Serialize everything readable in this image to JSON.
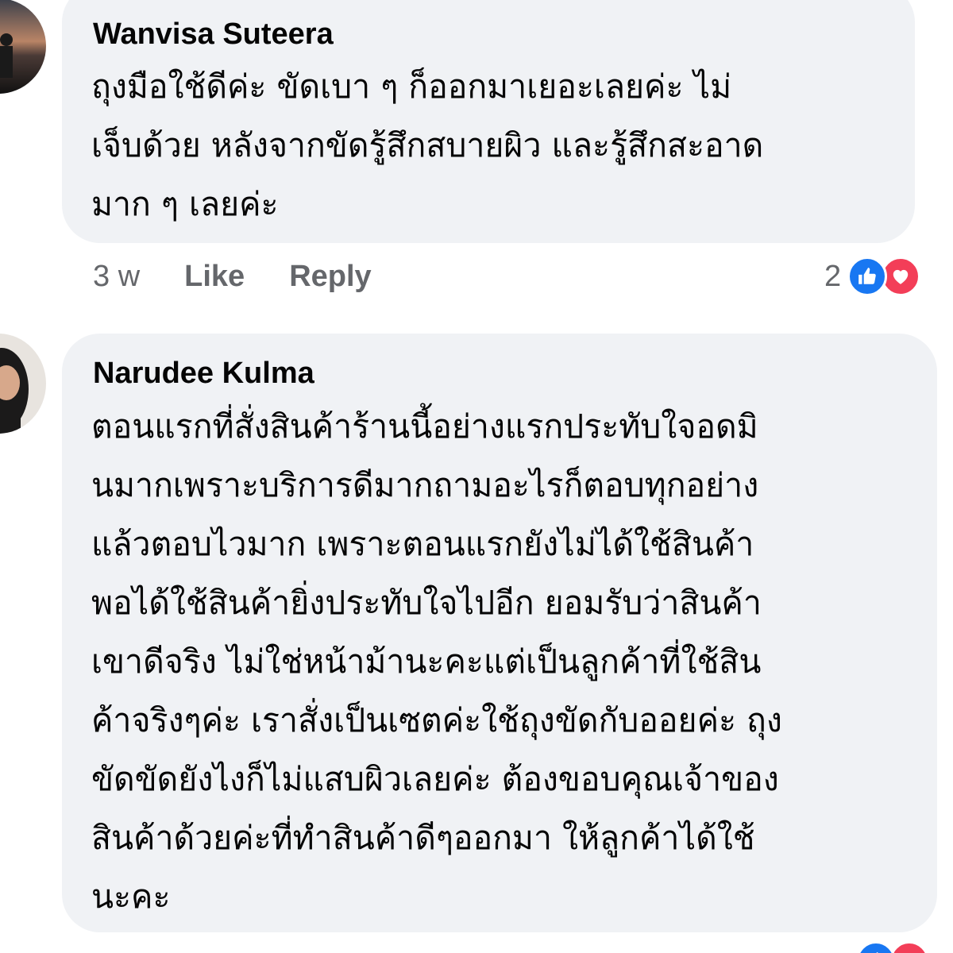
{
  "comments": [
    {
      "author": "Wanvisa Suteera",
      "lines": [
        "ถุงมือใช้ดีค่ะ ขัดเบา ๆ ก็ออกมาเยอะเลยค่ะ ไม่",
        "เจ็บด้วย หลังจากขัดรู้สึกสบายผิว และรู้สึกสะอาด",
        "มาก ๆ เลยค่ะ"
      ],
      "timestamp": "3 w",
      "like_label": "Like",
      "reply_label": "Reply",
      "reaction_count": "2",
      "reactions": [
        "like-icon",
        "love-icon"
      ]
    },
    {
      "author": "Narudee Kulma",
      "lines": [
        "ตอนแรกที่สั่งสินค้าร้านนี้อย่างแรกประทับใจอดมิ",
        "นมากเพราะบริการดีมากถามอะไรก็ตอบทุกอย่าง",
        "แล้วตอบไวมาก เพราะตอนแรกยังไม่ได้ใช้สินค้า",
        "พอได้ใช้สินค้ายิ่งประทับใจไปอีก ยอมรับว่าสินค้า",
        "เขาดีจริง ไม่ใช่หน้าม้านะคะแต่เป็นลูกค้าที่ใช้สิน",
        "ค้าจริงๆค่ะ เราสั่งเป็นเซตค่ะใช้ถุงขัดกับออยค่ะ ถุง",
        "ขัดขัดยังไงก็ไม่แสบผิวเลยค่ะ ต้องขอบคุณเจ้าของ",
        "สินค้าด้วยค่ะที่ทำสินค้าดีๆออกมา ให้ลูกค้าได้ใช้",
        "นะคะ"
      ],
      "reactions": [
        "like-icon",
        "love-icon"
      ]
    }
  ],
  "colors": {
    "bubble": "#f0f2f5",
    "text": "#050505",
    "secondary": "#65676b",
    "like": "#1877f2",
    "love": "#f33e58"
  }
}
